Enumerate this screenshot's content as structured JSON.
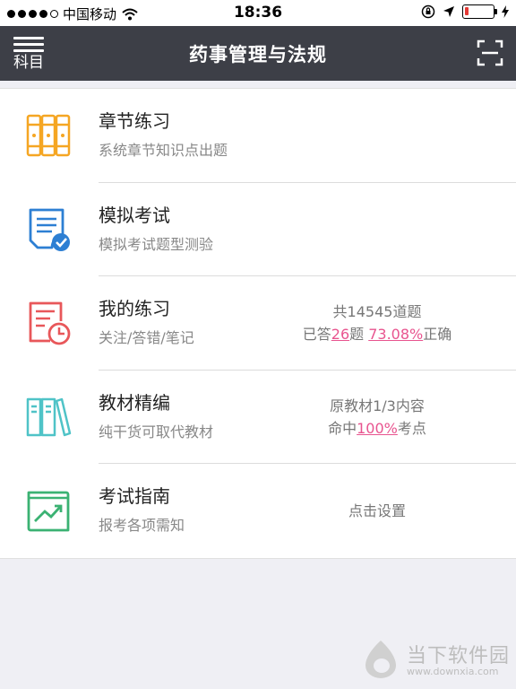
{
  "status_bar": {
    "carrier": "中国移动",
    "time": "18:36"
  },
  "nav": {
    "subject_label": "科目",
    "title": "药事管理与法规"
  },
  "items": [
    {
      "title": "章节练习",
      "subtitle": "系统章节知识点出题",
      "icon": "binder-icon",
      "color": "#f5a623"
    },
    {
      "title": "模拟考试",
      "subtitle": "模拟考试题型测验",
      "icon": "exam-check-icon",
      "color": "#2d7fd3"
    },
    {
      "title": "我的练习",
      "subtitle": "关注/答错/笔记",
      "icon": "practice-clock-icon",
      "color": "#e8575a",
      "stat_total": "共14545道题",
      "stat_prefix": "已答",
      "stat_answered": "26",
      "stat_mid": "题 ",
      "stat_rate": "73.08%",
      "stat_suffix": "正确"
    },
    {
      "title": "教材精编",
      "subtitle": "纯干货可取代教材",
      "icon": "books-icon",
      "color": "#4fc3c7",
      "stat_line1": "原教材1/3内容",
      "stat_prefix": "命中",
      "stat_hit": "100%",
      "stat_suffix": "考点"
    },
    {
      "title": "考试指南",
      "subtitle": "报考各项需知",
      "icon": "guide-chart-icon",
      "color": "#3bb273",
      "action": "点击设置"
    }
  ],
  "colors": {
    "nav_bg": "#3d3f47",
    "highlight": "#e8548f"
  },
  "watermark": {
    "name": "当下软件园",
    "url": "www.downxia.com"
  }
}
